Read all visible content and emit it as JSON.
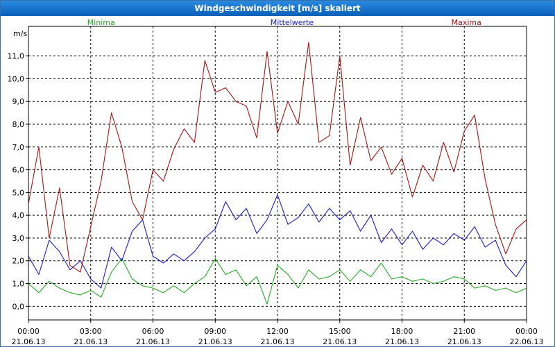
{
  "window": {
    "title": "Windgeschwindigkeit [m/s] skaliert"
  },
  "chart_data": {
    "type": "line",
    "title": "Windgeschwindigkeit [m/s] skaliert",
    "ylabel": "m/s",
    "xlabel": "",
    "ylim": [
      -0.6,
      12.3
    ],
    "xlim_hours": [
      0,
      24
    ],
    "yticks": [
      "0,0",
      "1,0",
      "2,0",
      "3,0",
      "4,0",
      "5,0",
      "6,0",
      "7,0",
      "8,0",
      "9,0",
      "10,0",
      "11,0"
    ],
    "xticks": [
      {
        "hour": 0,
        "time": "00:00",
        "date": "21.06.13"
      },
      {
        "hour": 3,
        "time": "03:00",
        "date": "21.06.13"
      },
      {
        "hour": 6,
        "time": "06:00",
        "date": "21.06.13"
      },
      {
        "hour": 9,
        "time": "09:00",
        "date": "21.06.13"
      },
      {
        "hour": 12,
        "time": "12:00",
        "date": "21.06.13"
      },
      {
        "hour": 15,
        "time": "15:00",
        "date": "21.06.13"
      },
      {
        "hour": 18,
        "time": "18:00",
        "date": "21.06.13"
      },
      {
        "hour": 21,
        "time": "21:00",
        "date": "21.06.13"
      },
      {
        "hour": 24,
        "time": "00:00",
        "date": "22.06.13"
      }
    ],
    "grid": true,
    "legend_position": "top",
    "series": [
      {
        "name": "Minima",
        "color": "#22aa22",
        "legend_hour": 3.5,
        "x": [
          0,
          0.5,
          1,
          1.5,
          2,
          2.5,
          3,
          3.5,
          4,
          4.5,
          5,
          5.5,
          6,
          6.5,
          7,
          7.5,
          8,
          8.5,
          9,
          9.5,
          10,
          10.5,
          11,
          11.5,
          12,
          12.5,
          13,
          13.5,
          14,
          14.5,
          15,
          15.5,
          16,
          16.5,
          17,
          17.5,
          18,
          18.5,
          19,
          19.5,
          20,
          20.5,
          21,
          21.5,
          22,
          22.5,
          23,
          23.5,
          24
        ],
        "values": [
          1.0,
          0.6,
          1.1,
          0.8,
          0.6,
          0.5,
          0.7,
          0.4,
          1.5,
          2.1,
          1.2,
          0.9,
          0.8,
          0.6,
          0.9,
          0.6,
          1.0,
          1.3,
          2.1,
          1.4,
          1.6,
          0.9,
          1.3,
          0.1,
          1.8,
          1.4,
          0.8,
          1.6,
          1.2,
          1.3,
          1.6,
          1.1,
          1.6,
          1.3,
          1.9,
          1.2,
          1.3,
          1.1,
          1.2,
          1.0,
          1.1,
          1.3,
          1.2,
          0.8,
          0.9,
          0.7,
          0.8,
          0.6,
          0.8
        ]
      },
      {
        "name": "Mittelwerte",
        "color": "#1a1acc",
        "legend_hour": 12.7,
        "x": [
          0,
          0.5,
          1,
          1.5,
          2,
          2.5,
          3,
          3.5,
          4,
          4.5,
          5,
          5.5,
          6,
          6.5,
          7,
          7.5,
          8,
          8.5,
          9,
          9.5,
          10,
          10.5,
          11,
          11.5,
          12,
          12.5,
          13,
          13.5,
          14,
          14.5,
          15,
          15.5,
          16,
          16.5,
          17,
          17.5,
          18,
          18.5,
          19,
          19.5,
          20,
          20.5,
          21,
          21.5,
          22,
          22.5,
          23,
          23.5,
          24
        ],
        "values": [
          2.2,
          1.4,
          2.9,
          2.4,
          1.6,
          2.0,
          1.2,
          0.8,
          2.6,
          2.0,
          3.3,
          3.8,
          2.2,
          1.9,
          2.3,
          2.0,
          2.4,
          3.0,
          3.4,
          4.6,
          3.8,
          4.3,
          3.2,
          3.8,
          4.9,
          3.6,
          3.9,
          4.5,
          3.7,
          4.3,
          3.8,
          4.2,
          3.3,
          4.0,
          2.8,
          3.4,
          2.7,
          3.3,
          2.5,
          3.0,
          2.7,
          3.2,
          2.9,
          3.5,
          2.6,
          2.9,
          1.8,
          1.3,
          2.0
        ]
      },
      {
        "name": "Maxima",
        "color": "#aa1111",
        "legend_hour": 21.1,
        "x": [
          0,
          0.5,
          1,
          1.5,
          2,
          2.5,
          3,
          3.5,
          4,
          4.5,
          5,
          5.5,
          6,
          6.5,
          7,
          7.5,
          8,
          8.5,
          9,
          9.5,
          10,
          10.5,
          11,
          11.5,
          12,
          12.5,
          13,
          13.5,
          14,
          14.5,
          15,
          15.5,
          16,
          16.5,
          17,
          17.5,
          18,
          18.5,
          19,
          19.5,
          20,
          20.5,
          21,
          21.5,
          22,
          22.5,
          23,
          23.5,
          24
        ],
        "values": [
          4.5,
          7.0,
          3.0,
          5.2,
          1.8,
          1.5,
          3.5,
          5.5,
          8.5,
          7.0,
          4.6,
          3.8,
          6.0,
          5.5,
          6.9,
          7.8,
          7.2,
          10.8,
          9.4,
          9.6,
          9.0,
          8.8,
          7.4,
          11.2,
          7.6,
          9.0,
          8.0,
          11.6,
          7.2,
          7.5,
          11.0,
          6.2,
          8.3,
          6.4,
          7.0,
          5.8,
          6.5,
          4.8,
          6.2,
          5.5,
          7.2,
          5.9,
          7.7,
          8.4,
          5.6,
          3.6,
          2.3,
          3.4,
          3.8
        ]
      }
    ]
  }
}
